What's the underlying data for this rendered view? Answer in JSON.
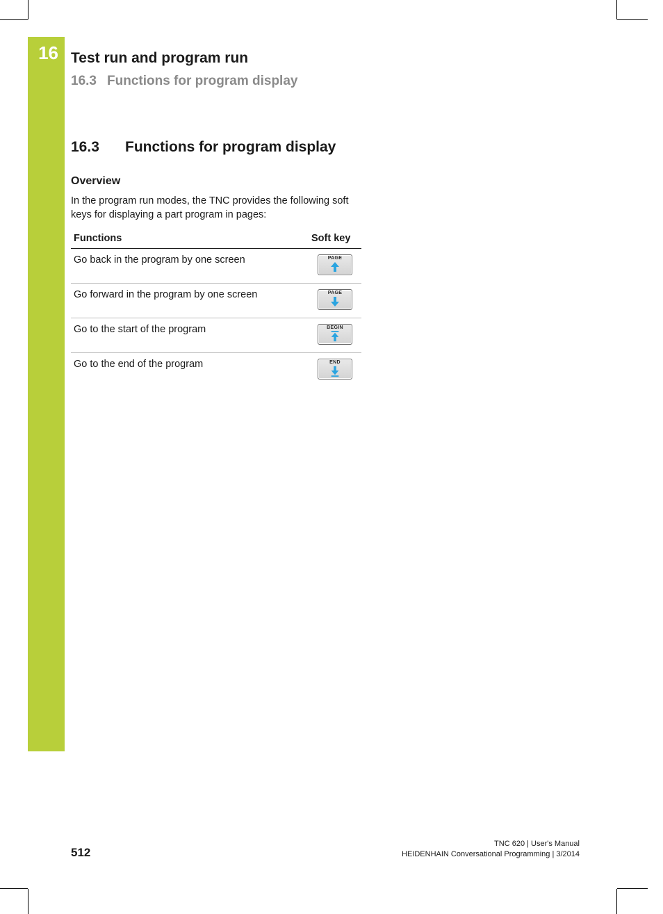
{
  "chapter": {
    "number": "16",
    "title": "Test run and program run"
  },
  "section_header": {
    "number": "16.3",
    "title": "Functions for program display"
  },
  "section": {
    "number": "16.3",
    "title": "Functions for program display",
    "overview_label": "Overview",
    "intro": "In the program run modes, the TNC provides the following soft keys for displaying a part program in pages:"
  },
  "table": {
    "head_functions": "Functions",
    "head_softkey": "Soft key",
    "rows": [
      {
        "fn": "Go back in the program by one screen",
        "key_label": "PAGE",
        "key_icon": "arrow-up-icon"
      },
      {
        "fn": "Go forward in the program by one screen",
        "key_label": "PAGE",
        "key_icon": "arrow-down-icon"
      },
      {
        "fn": "Go to the start of the program",
        "key_label": "BEGIN",
        "key_icon": "arrow-up-bar-icon"
      },
      {
        "fn": "Go to the end of the program",
        "key_label": "END",
        "key_icon": "arrow-down-bar-icon"
      }
    ]
  },
  "footer": {
    "page": "512",
    "line1": "TNC 620 | User's Manual",
    "line2": "HEIDENHAIN Conversational Programming | 3/2014"
  }
}
